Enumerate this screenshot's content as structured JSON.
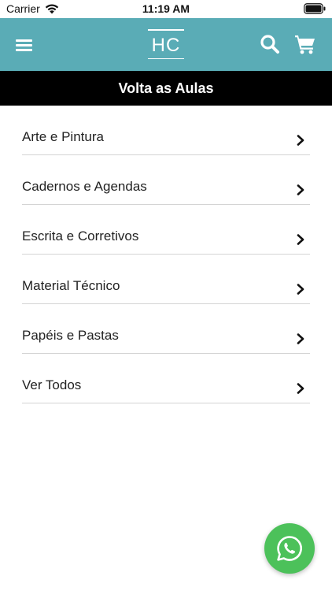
{
  "status_bar": {
    "carrier": "Carrier",
    "time": "11:19 AM",
    "icons": [
      "wifi-icon",
      "battery-icon"
    ]
  },
  "header": {
    "logo_text": "HC",
    "background_color": "#5aacb6",
    "icons": [
      "menu-icon",
      "search-icon",
      "cart-icon"
    ]
  },
  "section": {
    "title": "Volta as Aulas",
    "background_color": "#000000"
  },
  "categories": [
    {
      "label": "Arte e Pintura"
    },
    {
      "label": "Cadernos e Agendas"
    },
    {
      "label": "Escrita e Corretivos"
    },
    {
      "label": "Material Técnico"
    },
    {
      "label": "Papéis e Pastas"
    },
    {
      "label": "Ver Todos"
    }
  ],
  "floating_action": {
    "icon": "whatsapp-icon",
    "color": "#4cc15a"
  }
}
